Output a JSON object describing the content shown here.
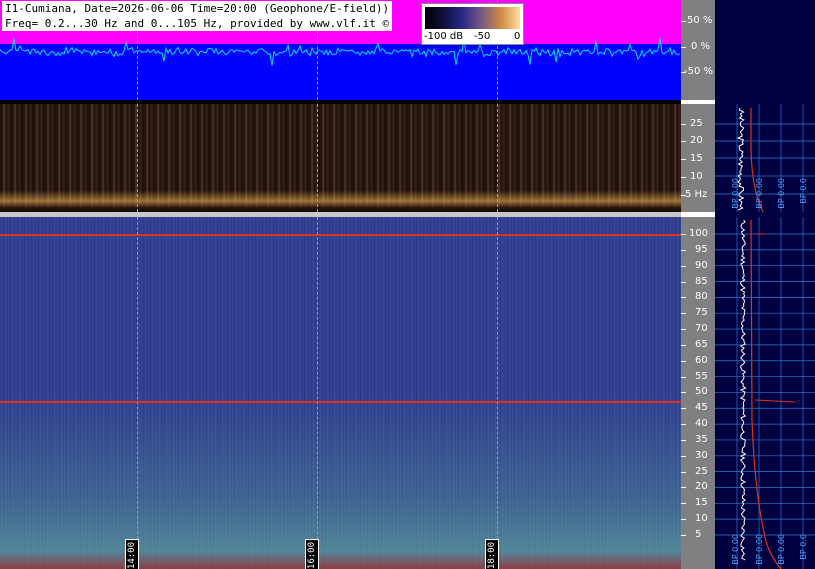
{
  "header": {
    "title_line1": "I1-Cumiana, Date=2026-06-06 Time=20:00 (Geophone/E-field))",
    "title_line2": "Freq= 0.2...30 Hz and 0...105 Hz, provided by www.vlf.it ©"
  },
  "colorbar": {
    "label_min": "-100 dB",
    "label_mid": "-50",
    "label_max": "0"
  },
  "wave_scale": {
    "labels": [
      "50 %",
      "0 %",
      "-50 %"
    ]
  },
  "top_scale": {
    "labels": [
      "25",
      "20",
      "15",
      "10",
      "5 Hz"
    ]
  },
  "main_scale": {
    "labels": [
      "100",
      "95",
      "90",
      "85",
      "80",
      "75",
      "70",
      "65",
      "60",
      "55",
      "50",
      "45",
      "40",
      "35",
      "30",
      "25",
      "20",
      "15",
      "10",
      "5"
    ]
  },
  "time_markers": {
    "labels": [
      "14:00",
      "16:00",
      "18:00"
    ]
  },
  "side_panel": {
    "top_bp_labels": [
      "BP 0.00",
      "BP 0.00",
      "BP 0.00",
      "BP 0.0"
    ],
    "main_bp_labels": [
      "BP 0.00",
      "BP 0.00",
      "BP 0.00",
      "BP 0.0"
    ]
  },
  "colors": {
    "wave_bg": "#0000ff",
    "wave_upper": "#ff00ff",
    "trace": "#00e0e0",
    "marker_line": "#e03020",
    "side_bg": "#000040",
    "side_grid": "#2a7ad0"
  }
}
